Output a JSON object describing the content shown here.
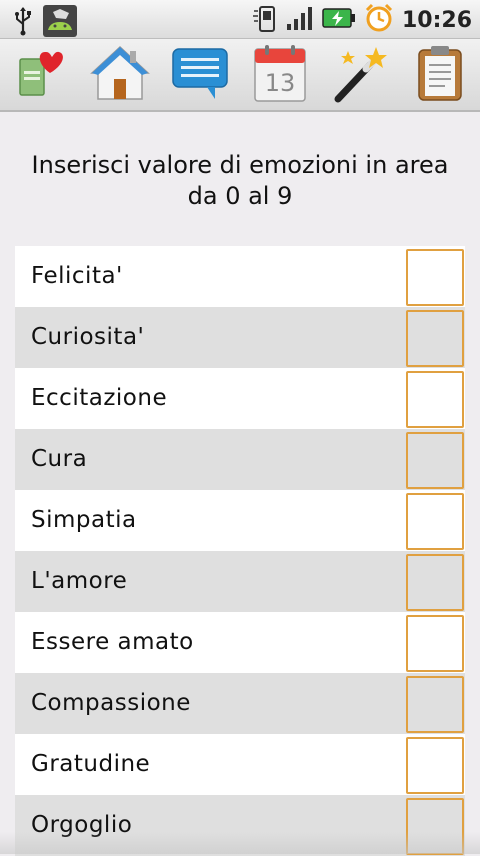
{
  "status_bar": {
    "time": "10:26",
    "icons": [
      "usb-icon",
      "android-debug-icon",
      "phone-signal-icon",
      "signal-bars-icon",
      "battery-charging-icon",
      "alarm-clock-icon"
    ]
  },
  "toolbar": {
    "buttons": [
      {
        "name": "diary-heart-button",
        "icon": "diary-heart-icon"
      },
      {
        "name": "home-button",
        "icon": "home-icon"
      },
      {
        "name": "chat-button",
        "icon": "speech-bubble-icon"
      },
      {
        "name": "calendar-button",
        "icon": "calendar-icon",
        "text": "13"
      },
      {
        "name": "magic-wand-button",
        "icon": "magic-wand-icon"
      },
      {
        "name": "clipboard-button",
        "icon": "clipboard-icon"
      }
    ]
  },
  "heading": {
    "line1": "Inserisci valore di emozioni in area",
    "line2": "da 0 al 9"
  },
  "emotions": [
    {
      "label": "Felicita'",
      "value": ""
    },
    {
      "label": "Curiosita'",
      "value": ""
    },
    {
      "label": "Eccitazione",
      "value": ""
    },
    {
      "label": "Cura",
      "value": ""
    },
    {
      "label": "Simpatia",
      "value": ""
    },
    {
      "label": "L'amore",
      "value": ""
    },
    {
      "label": "Essere amato",
      "value": ""
    },
    {
      "label": "Compassione",
      "value": ""
    },
    {
      "label": "Gratudine",
      "value": ""
    },
    {
      "label": "Orgoglio",
      "value": ""
    }
  ],
  "colors": {
    "input_border": "#e0a040",
    "row_alt": "#dfdfdf",
    "battery": "#3bb54a",
    "alarm": "#f0a020"
  }
}
